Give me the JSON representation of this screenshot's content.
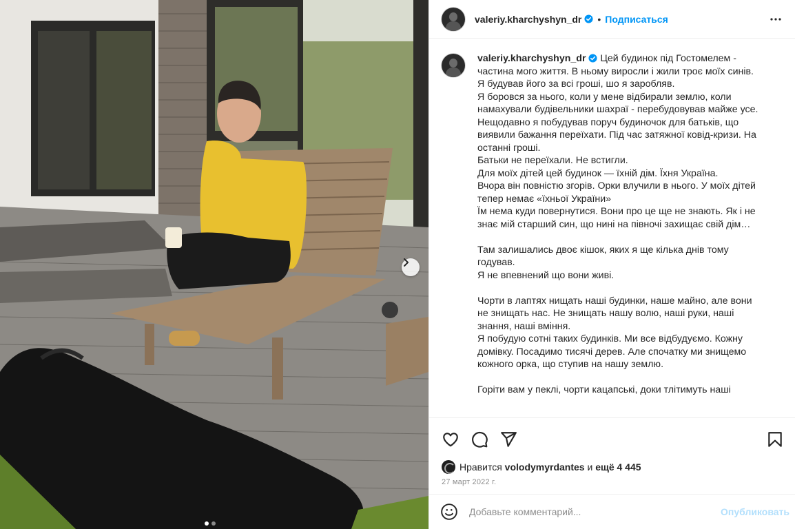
{
  "post": {
    "username": "valeriy.kharchyshyn_dr",
    "separator": "•",
    "follow_label": "Подписаться",
    "caption_lines": [
      "Цей будинок під Гостомелем -",
      "частина мого життя. В ньому виросли і жили троє моїх синів.",
      "Я будував його за всі гроші, шо я заробляв.",
      "Я боровся за нього, коли у мене відбирали землю, коли",
      "намахували будівельники шахраї - перебудовував майже усе.",
      "Нещодавно я побудував поруч будиночок для батьків, що",
      "виявили бажання переїхати. Під час затяжної ковід-кризи. На",
      "останні гроші.",
      "Батьки не переїхали. Не встигли.",
      "Для моїх дітей цей будинок — їхній дім. Їхня Україна.",
      "Вчора він повністю згорів. Орки влучили в нього. У моїх дітей",
      "тепер немає «їхньої України»",
      "Їм нема куди повернутися. Вони про це ще не знають. Як і не",
      "знає мій старший син, що нині на півночі захищає свій дім…",
      "",
      "Там залишались двоє кішок, яких я ще кілька днів тому",
      "годував.",
      "Я не впевнений що вони живі.",
      "",
      "Чорти в лаптях нищать наші будинки, наше майно, але вони",
      "не знищать нас. Не знищать нашу волю, наші руки, наші",
      "знання, наші вміння.",
      "Я побудую сотні таких будинків. Ми все відбудуємо. Кожну",
      "домівку. Посадимо тисячі дерев. Але спочатку ми знищемо",
      "кожного орка, що ступив на нашу землю.",
      "",
      "Горіти вам у пеклі, чорти кацапські, доки тлітимуть наші"
    ],
    "likes_prefix": "Нравится",
    "likes_user": "volodymyrdantes",
    "likes_middle": "и",
    "likes_count": "ещё 4 445",
    "date": "27 март 2022 г.",
    "comment_placeholder": "Добавьте комментарий...",
    "publish_label": "Опубликовать",
    "carousel": {
      "total": 2,
      "current": 1
    }
  },
  "colors": {
    "accent": "#0095f6",
    "publish_disabled": "#b2dffc",
    "verified": "#0095f6"
  },
  "icons": {
    "verified": "verified-badge-icon",
    "more": "more-options-icon",
    "like": "heart-icon",
    "comment": "comment-icon",
    "share": "send-icon",
    "save": "bookmark-icon",
    "emoji": "emoji-icon",
    "next": "chevron-right-icon"
  }
}
